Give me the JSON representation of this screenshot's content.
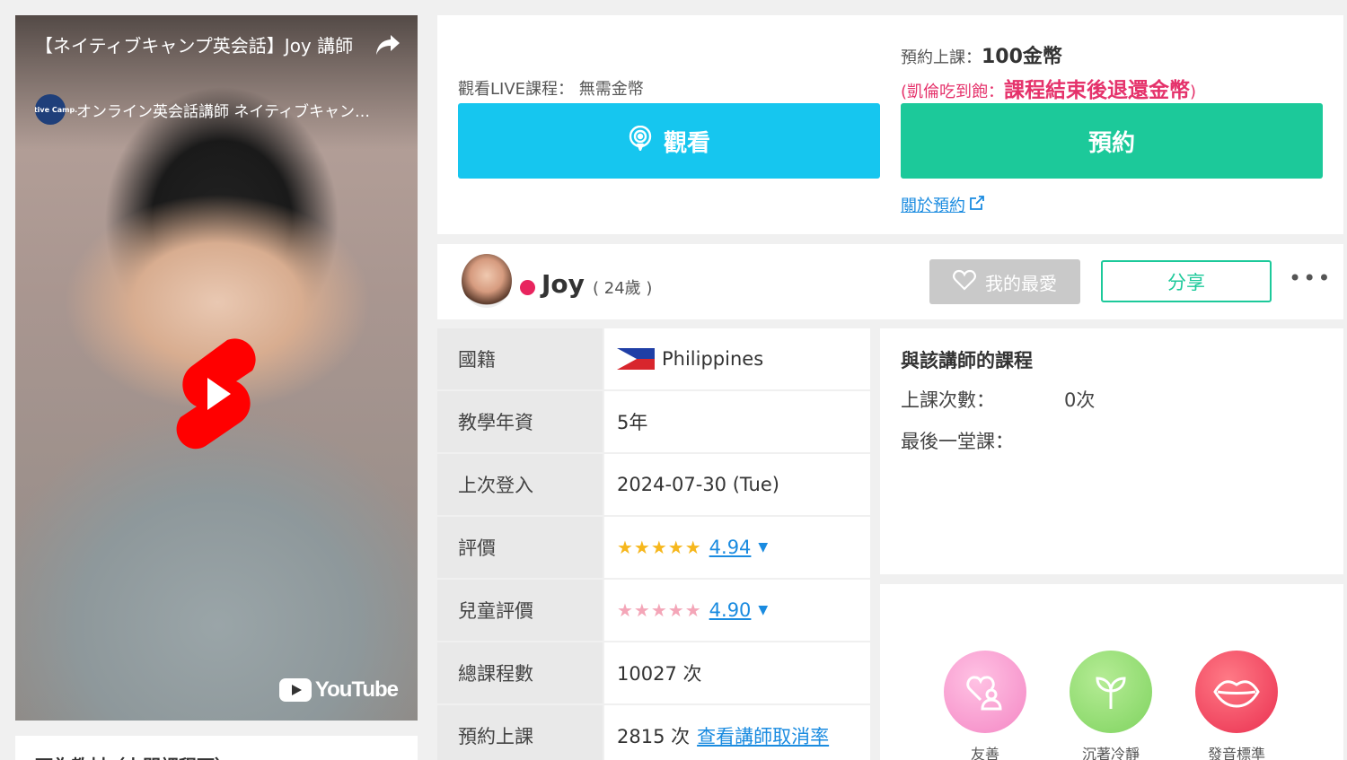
{
  "video": {
    "title": "【ネイティブキャンプ英会話】Joy 講師",
    "channel": "オンライン英会話講師 ネイティブキャン…",
    "channel_logo_text": "Native Camp.",
    "platform": "YouTube"
  },
  "below_video": {
    "heading": "可為教材（上門課程可）"
  },
  "booking": {
    "watch_label": "觀看LIVE課程：",
    "watch_value": "無需金幣",
    "price_label": "預約上課：",
    "price_value": "100金幣",
    "refund_prefix": "(凱倫吃到飽：",
    "refund_value": "課程結束後退還金幣",
    "refund_suffix": ")",
    "watch_button": "觀看",
    "book_button": "預約",
    "about_link": "關於預約"
  },
  "teacher": {
    "name": "Joy",
    "age": "( 24歲 )",
    "favorite_button": "我的最愛",
    "share_button": "分享",
    "more": "•••",
    "status_color": "#e8245e"
  },
  "info": {
    "nationality_label": "國籍",
    "nationality_value": "Philippines",
    "experience_label": "教學年資",
    "experience_value": "5年",
    "last_login_label": "上次登入",
    "last_login_value": "2024-07-30 (Tue)",
    "rating_label": "評價",
    "rating_value": "4.94",
    "kids_rating_label": "兒童評價",
    "kids_rating_value": "4.90",
    "total_label": "總課程數",
    "total_value": "10027 次",
    "reserved_label": "預約上課",
    "reserved_value": "2815 次",
    "cancel_link": "查看講師取消率"
  },
  "lessons": {
    "heading": "與該講師的課程",
    "count_label": "上課次數：",
    "count_value": "0次",
    "last_label": "最後一堂課："
  },
  "traits": [
    {
      "label": "友善",
      "icon": "friendly-icon",
      "color": "#f79ad0"
    },
    {
      "label": "沉著冷靜",
      "icon": "sprout-icon",
      "color": "#8fdb70"
    },
    {
      "label": "發音標準",
      "icon": "lips-icon",
      "color": "#f0465c"
    }
  ],
  "colors": {
    "watch": "#16c6ef",
    "book": "#1cc99a",
    "link": "#1a8be0",
    "accent_red": "#e5326b"
  }
}
